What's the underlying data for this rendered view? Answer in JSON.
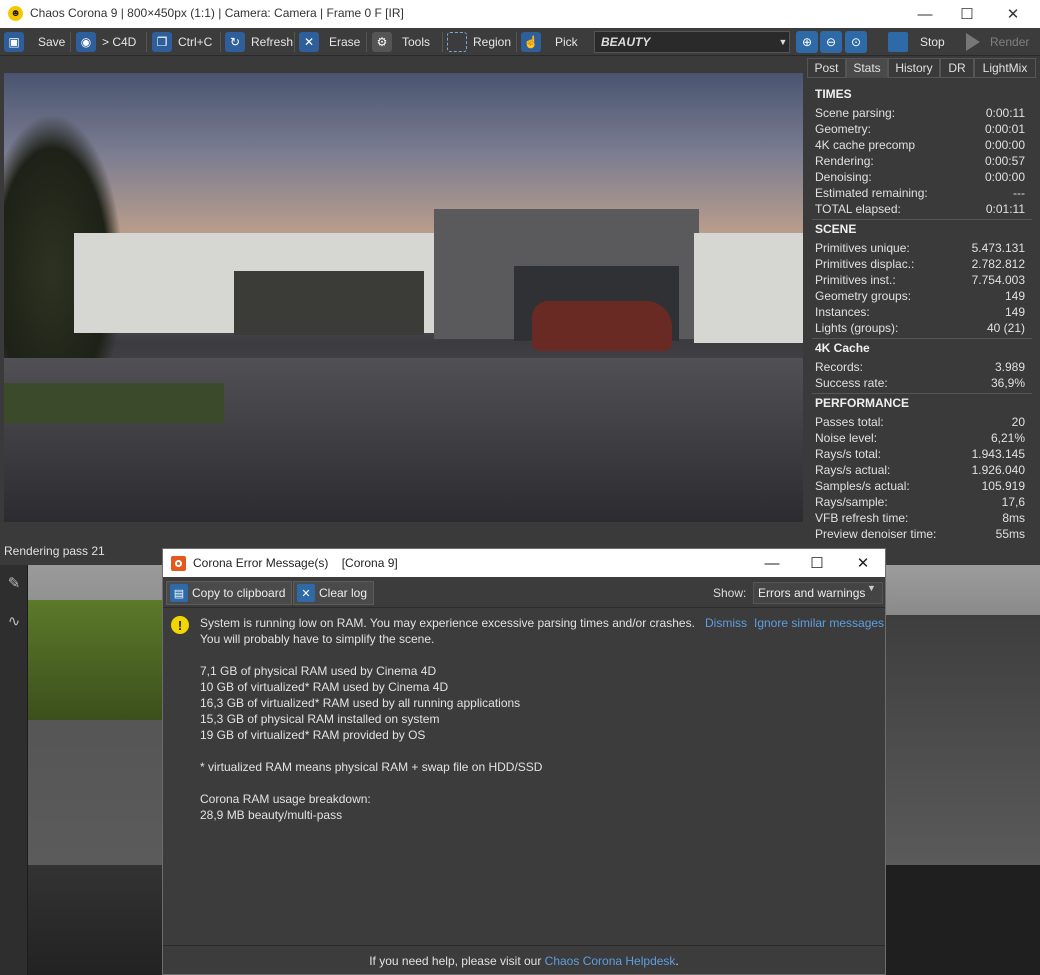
{
  "window": {
    "title": "Chaos Corona 9 | 800×450px (1:1) | Camera: Camera | Frame 0 F [IR]"
  },
  "toolbar": {
    "save": "Save",
    "to_c4d": "> C4D",
    "ctrl_c": "Ctrl+C",
    "refresh": "Refresh",
    "erase": "Erase",
    "tools": "Tools",
    "region": "Region",
    "pick": "Pick",
    "channel": "BEAUTY",
    "stop": "Stop",
    "render": "Render"
  },
  "status": "Rendering pass 21",
  "panel_tabs": [
    "Post",
    "Stats",
    "History",
    "DR",
    "LightMix"
  ],
  "stats": {
    "times": {
      "heading": "TIMES",
      "rows": [
        {
          "label": "Scene parsing:",
          "value": "0:00:11"
        },
        {
          "label": "Geometry:",
          "value": "0:00:01"
        },
        {
          "label": "4K cache precomp",
          "value": "0:00:00"
        },
        {
          "label": "Rendering:",
          "value": "0:00:57"
        },
        {
          "label": "Denoising:",
          "value": "0:00:00"
        },
        {
          "label": "Estimated remaining:",
          "value": "---"
        },
        {
          "label": "TOTAL elapsed:",
          "value": "0:01:11"
        }
      ]
    },
    "scene": {
      "heading": "SCENE",
      "rows": [
        {
          "label": "Primitives unique:",
          "value": "5.473.131"
        },
        {
          "label": "Primitives displac.:",
          "value": "2.782.812"
        },
        {
          "label": "Primitives inst.:",
          "value": "7.754.003"
        },
        {
          "label": "Geometry groups:",
          "value": "149"
        },
        {
          "label": "Instances:",
          "value": "149"
        },
        {
          "label": "Lights (groups):",
          "value": "40 (21)"
        }
      ]
    },
    "cache": {
      "heading": "4K Cache",
      "rows": [
        {
          "label": "Records:",
          "value": "3.989"
        },
        {
          "label": "Success rate:",
          "value": "36,9%"
        }
      ]
    },
    "performance": {
      "heading": "PERFORMANCE",
      "rows": [
        {
          "label": "Passes total:",
          "value": "20"
        },
        {
          "label": "Noise level:",
          "value": "6,21%"
        },
        {
          "label": "Rays/s total:",
          "value": "1.943.145"
        },
        {
          "label": "Rays/s actual:",
          "value": "1.926.040"
        },
        {
          "label": "Samples/s actual:",
          "value": "105.919"
        },
        {
          "label": "Rays/sample:",
          "value": "17,6"
        },
        {
          "label": "VFB refresh time:",
          "value": "8ms"
        },
        {
          "label": "Preview denoiser time:",
          "value": "55ms"
        }
      ]
    }
  },
  "dialog": {
    "title": "Corona Error Message(s)    [Corona 9]",
    "copy_btn": "Copy to clipboard",
    "clear_btn": "Clear log",
    "show_label": "Show:",
    "show_value": "Errors and warnings",
    "dismiss": "Dismiss",
    "ignore": "Ignore similar messages",
    "message_lines": [
      "System is running low on RAM. You may experience excessive parsing times and/or crashes.",
      "You will probably have to simplify the scene.",
      "",
      "7,1 GB of physical RAM used by Cinema 4D",
      "10 GB of virtualized* RAM used by Cinema 4D",
      "16,3 GB of virtualized* RAM used by all running applications",
      "15,3 GB of physical RAM installed on system",
      "19 GB of virtualized* RAM provided by OS",
      "",
      "* virtualized RAM means physical RAM + swap file on HDD/SSD",
      "",
      "Corona RAM usage breakdown:",
      "28,9 MB beauty/multi-pass"
    ],
    "footer_prefix": "If you need help, please visit our ",
    "footer_link": "Chaos Corona Helpdesk",
    "footer_suffix": "."
  },
  "colors": {
    "accent_blue": "#2f6aa8",
    "link_blue": "#5d9fe0",
    "warning_yellow": "#f2d600",
    "corona_orange": "#e5591c"
  }
}
